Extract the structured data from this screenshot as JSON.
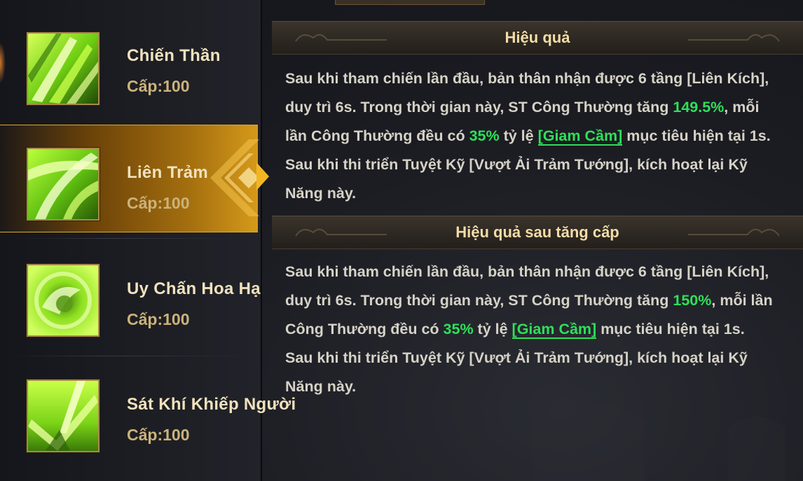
{
  "skills": [
    {
      "name": "Chiến Thần",
      "level": "Cấp:100",
      "icon": "green-slash-skill-icon"
    },
    {
      "name": "Liên Trảm",
      "level": "Cấp:100",
      "icon": "green-wind-blade-skill-icon",
      "selected": true
    },
    {
      "name": "Uy Chấn Hoa Hạ",
      "level": "Cấp:100",
      "icon": "green-swirl-skill-icon"
    },
    {
      "name": "Sát Khí Khiếp Người",
      "level": "Cấp:100",
      "icon": "green-spike-skill-icon"
    }
  ],
  "effect": {
    "title": "Hiệu quả",
    "p1": "Sau khi tham chiến lần đầu, bản thân nhận được 6 tầng [Liên Kích], duy trì 6s. Trong thời gian này, ST Công Thường tăng ",
    "value1": "149.5%",
    "p2": ", mỗi lần Công Thường đều có ",
    "chance": "35%",
    "p3": " tỷ lệ ",
    "status": "[Giam Cầm]",
    "p4": " mục tiêu hiện tại 1s. Sau khi thi triển Tuyệt Kỹ [Vượt Ải Trảm Tướng], kích hoạt lại Kỹ Năng này."
  },
  "upgrade_effect": {
    "title": "Hiệu quả sau tăng cấp",
    "p1": "Sau khi tham chiến lần đầu, bản thân nhận được 6 tầng [Liên Kích], duy trì 6s. Trong thời gian này, ST Công Thường tăng ",
    "value1": "150%",
    "p2": ", mỗi lần Công Thường đều có ",
    "chance": "35%",
    "p3": " tỷ lệ ",
    "status": "[Giam Cầm]",
    "p4": " mục tiêu hiện tại 1s. Sau khi thi triển Tuyệt Kỹ [Vượt Ải Trảm Tướng], kích hoạt lại Kỹ Năng này."
  },
  "colors": {
    "highlight_green": "#2ee05a",
    "selected_gold": "#d59a1a",
    "header_text": "#f3dca6"
  }
}
